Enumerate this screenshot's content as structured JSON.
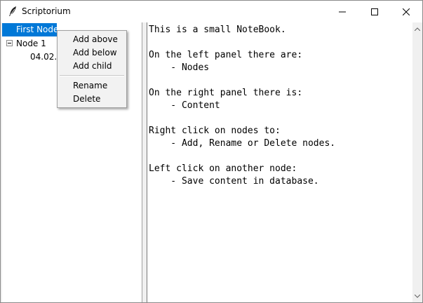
{
  "window": {
    "title": "Scriptorium",
    "icon": "quill-feather-icon"
  },
  "tree": {
    "selected_node": "First Node",
    "node1": {
      "label": "Node 1",
      "expanded": true
    },
    "node1_child_visible": "04.02.20"
  },
  "context_menu": {
    "items": [
      "Add above",
      "Add below",
      "Add child",
      "Rename",
      "Delete"
    ]
  },
  "content": {
    "text": "This is a small NoteBook.\n\nOn the left panel there are:\n    - Nodes\n\nOn the right panel there is:\n    - Content\n\nRight click on nodes to:\n    - Add, Rename or Delete nodes.\n\nLeft click on another node:\n    - Save content in database."
  },
  "colors": {
    "selection": "#0078d7",
    "window_bg": "#f0f0f0"
  }
}
